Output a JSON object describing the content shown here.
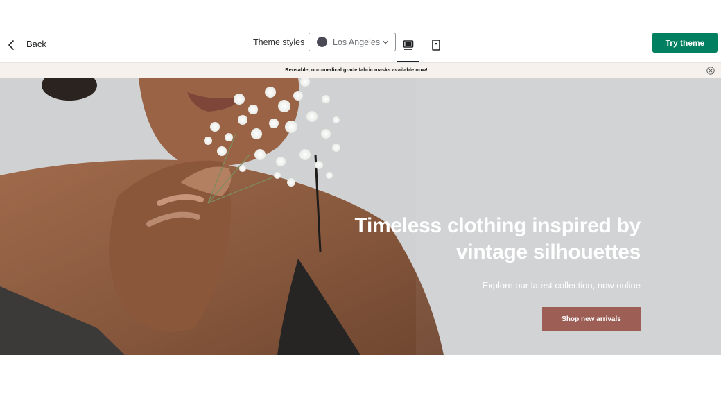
{
  "header": {
    "back_label": "Back",
    "theme_styles_label": "Theme styles",
    "theme_select": {
      "value": "Los Angeles",
      "swatch_color": "#4a4a55"
    },
    "view_modes": [
      {
        "name": "desktop",
        "icon": "desktop-icon",
        "active": true
      },
      {
        "name": "mobile",
        "icon": "mobile-icon",
        "active": false
      }
    ],
    "try_theme_label": "Try theme",
    "accent_color": "#008060"
  },
  "announcement": {
    "text": "Reusable, non-medical grade fabric masks available now!",
    "close_icon": "close-circle-icon"
  },
  "hero": {
    "title": "Timeless clothing inspired by vintage silhouettes",
    "subtitle": "Explore our latest collection, now online",
    "button_label": "Shop new arrivals",
    "button_color": "#9c5e55"
  }
}
